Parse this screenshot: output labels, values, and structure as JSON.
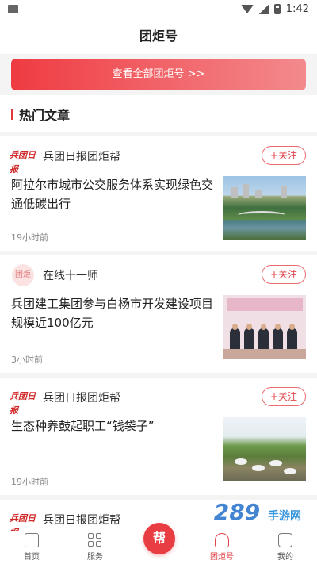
{
  "status_bar": {
    "time": "1:42"
  },
  "header": {
    "title": "团炬号"
  },
  "view_all_button": {
    "label": "查看全部团炬号 >>"
  },
  "section": {
    "title": "热门文章"
  },
  "articles": [
    {
      "source_logo": "兵团日报",
      "source": "兵团日报团炬帮",
      "follow_label": "+关注",
      "title": "阿拉尔市城市公交服务体系实现绿色交通低碳出行",
      "time": "19小时前"
    },
    {
      "source_logo": "团炬",
      "source": "在线十一师",
      "follow_label": "+关注",
      "title": "兵团建工集团参与白杨市开发建设项目规模近100亿元",
      "time": "3小时前"
    },
    {
      "source_logo": "兵团日报",
      "source": "兵团日报团炬帮",
      "follow_label": "+关注",
      "title": "生态种养鼓起职工“钱袋子”",
      "time": "19小时前"
    },
    {
      "source_logo": "兵团日报",
      "source": "兵团日报团炬帮"
    }
  ],
  "bottom_nav": {
    "items": [
      {
        "label": "首页",
        "icon": "home-icon"
      },
      {
        "label": "服务",
        "icon": "grid-icon"
      },
      {
        "label": "团炬号",
        "icon": "torch-icon"
      },
      {
        "label": "我的",
        "icon": "user-icon"
      }
    ],
    "center_button": "帮",
    "active": "团炬号"
  },
  "watermark": {
    "text": "289",
    "tail": "手游网"
  },
  "colors": {
    "accent": "#e3343b",
    "button_gradient_start": "#ef3b42",
    "button_gradient_end": "#f38a8d"
  }
}
